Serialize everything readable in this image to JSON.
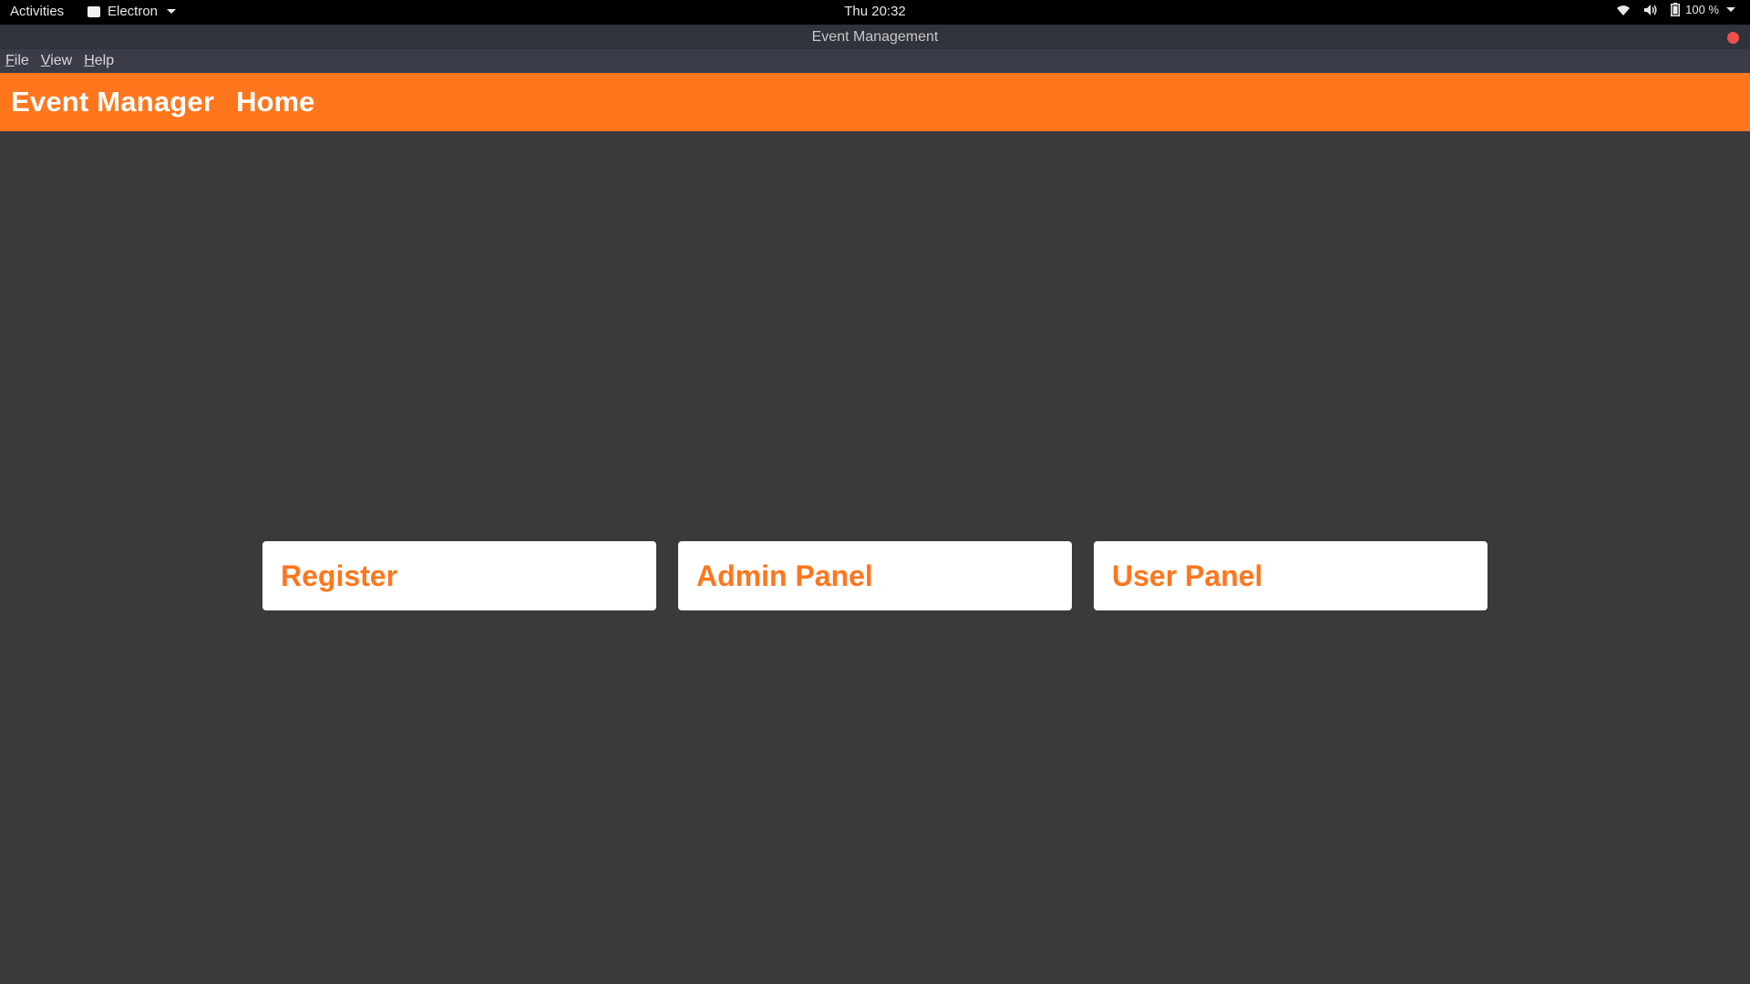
{
  "topbar": {
    "activities": "Activities",
    "app_name": "Electron",
    "clock": "Thu 20:32",
    "battery": "100 %",
    "icons": [
      "wifi-icon",
      "volume-icon",
      "battery-icon",
      "chevron-down-icon"
    ]
  },
  "window": {
    "title": "Event Management"
  },
  "menubar": {
    "items": [
      {
        "accel": "F",
        "rest": "ile"
      },
      {
        "accel": "V",
        "rest": "iew"
      },
      {
        "accel": "H",
        "rest": "elp"
      }
    ]
  },
  "navbar": {
    "brand": "Event Manager",
    "links": [
      "Home"
    ]
  },
  "cards": [
    {
      "label": "Register"
    },
    {
      "label": "Admin Panel"
    },
    {
      "label": "User Panel"
    }
  ],
  "colors": {
    "accent": "#ff761d",
    "background": "#3a3a3a",
    "card": "#ffffff",
    "close": "#f14e4e"
  }
}
